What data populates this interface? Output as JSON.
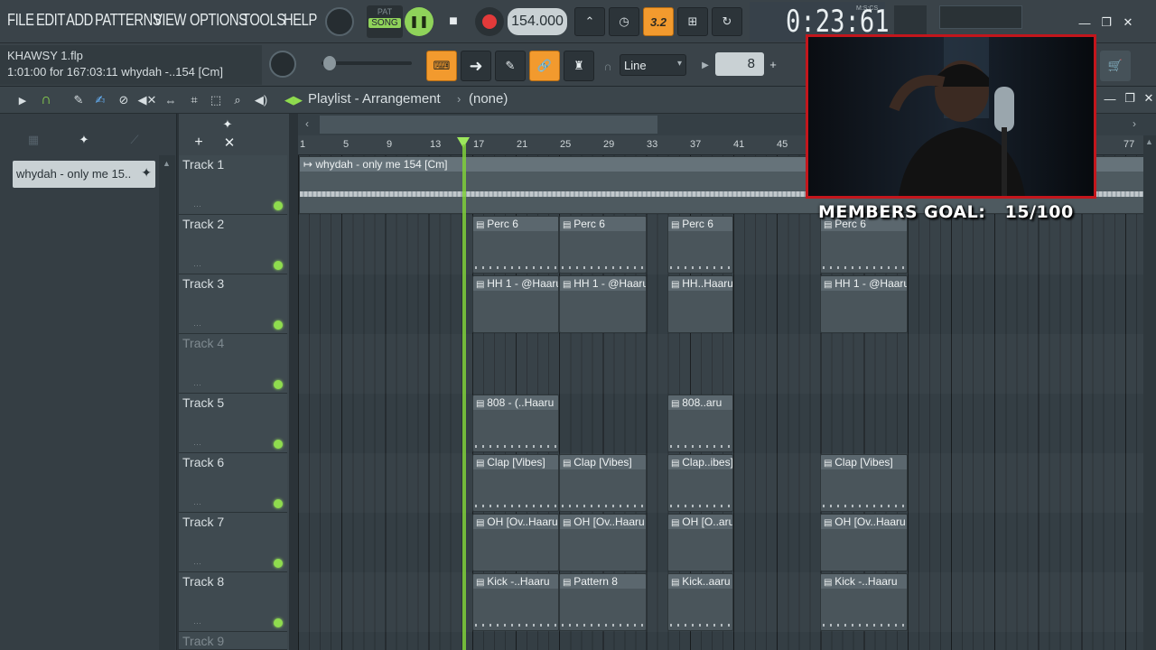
{
  "menu": {
    "items": [
      "FILE",
      "EDIT",
      "ADD",
      "PATTERNS",
      "VIEW",
      "OPTIONS",
      "TOOLS",
      "HELP"
    ]
  },
  "transport": {
    "pat_label": "PAT",
    "song_label": "SONG",
    "tempo": "154.000",
    "time": "0:23:61",
    "time_unit": "M:S:CS",
    "time_sig_btn": "3.2"
  },
  "project": {
    "filename": "KHAWSY 1.flp",
    "hint": "1:01:00 for 167:03:11  whydah -..154 [Cm]"
  },
  "snap": {
    "label": "Line",
    "step_value": "8"
  },
  "playlist": {
    "title": "Playlist - Arrangement",
    "pattern_selector": "(none)",
    "left_clip_label": "whydah - only me 15..",
    "ruler_ticks": [
      "1",
      "5",
      "9",
      "13",
      "17",
      "21",
      "25",
      "29",
      "33",
      "37",
      "41",
      "45",
      "77"
    ],
    "tracks": [
      "Track 1",
      "Track 2",
      "Track 3",
      "Track 4",
      "Track 5",
      "Track 6",
      "Track 7",
      "Track 8",
      "Track 9"
    ],
    "audio_clip": "whydah - only me 154 [Cm]",
    "clips": {
      "t2": [
        "Perc 6",
        "Perc 6",
        "Perc 6",
        "Perc 6"
      ],
      "t3": [
        "HH 1 - @Haaru",
        "HH 1 - @Haaru",
        "HH..Haaru",
        "HH 1 - @Haaru"
      ],
      "t5": [
        "808 - (..Haaru",
        "808..aru"
      ],
      "t6": [
        "Clap [Vibes]",
        "Clap [Vibes]",
        "Clap..ibes]",
        "Clap [Vibes]"
      ],
      "t7": [
        "OH [Ov..Haaru",
        "OH [Ov..Haaru",
        "OH [O..aru",
        "OH [Ov..Haaru"
      ],
      "t8": [
        "Kick -..Haaru",
        "Pattern 8",
        "Kick..aaru",
        "Kick -..Haaru"
      ]
    }
  },
  "overlay": {
    "members_goal": "MEMBERS GOAL:   15/100"
  },
  "colors": {
    "accent_orange": "#f29a2e",
    "led_green": "#8fdc4e",
    "playhead": "#7fcf3a",
    "webcam_border": "#c3161c"
  }
}
